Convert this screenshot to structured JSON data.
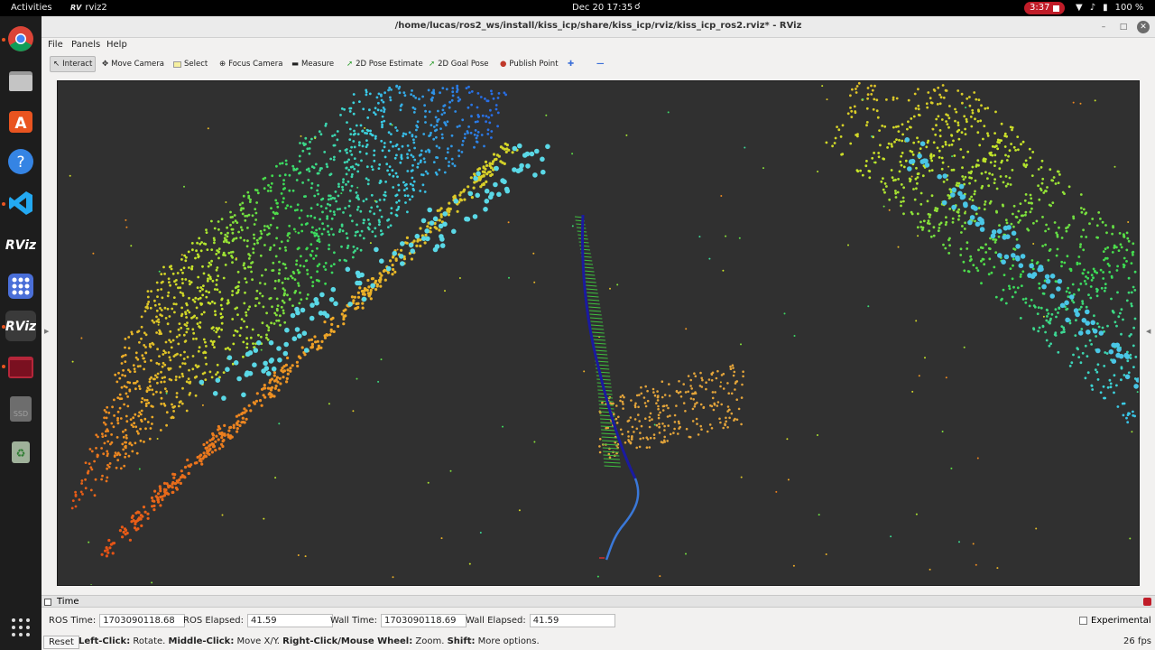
{
  "topbar": {
    "activities": "Activities",
    "app_name": "rviz2",
    "clock": "Dec 20  17:35",
    "recording": "3:37",
    "battery": "100 %"
  },
  "dock": {
    "items": [
      "Google Chrome",
      "Files",
      "Ubuntu Software",
      "Help",
      "Visual Studio Code",
      "RViz",
      "Show Applications",
      "RViz",
      "Terminal",
      "SSD",
      "Trash"
    ]
  },
  "window": {
    "title": "/home/lucas/ros2_ws/install/kiss_icp/share/kiss_icp/rviz/kiss_icp_ros2.rviz* - RViz"
  },
  "menu": {
    "file": "File",
    "panels": "Panels",
    "help": "Help"
  },
  "toolbar": {
    "interact": "Interact",
    "move_camera": "Move Camera",
    "select": "Select",
    "focus_camera": "Focus Camera",
    "measure": "Measure",
    "pose_estimate": "2D Pose Estimate",
    "goal_pose": "2D Goal Pose",
    "publish_point": "Publish Point"
  },
  "time_panel": {
    "title": "Time",
    "ros_time_label": "ROS Time:",
    "ros_time": "1703090118.68",
    "ros_elapsed_label": "ROS Elapsed:",
    "ros_elapsed": "41.59",
    "wall_time_label": "Wall Time:",
    "wall_time": "1703090118.69",
    "wall_elapsed_label": "Wall Elapsed:",
    "wall_elapsed": "41.59",
    "experimental": "Experimental"
  },
  "status": {
    "reset": "Reset",
    "left_click": "Left-Click:",
    "left_click_action": " Rotate. ",
    "middle_click": "Middle-Click:",
    "middle_click_action": " Move X/Y. ",
    "right_click": "Right-Click/Mouse Wheel:",
    "right_click_action": " Zoom. ",
    "shift": "Shift:",
    "shift_action": " More options.",
    "fps": "26 fps"
  },
  "colors": {
    "viewport_bg": "#303030",
    "trajectory_blue": "#3a78d8",
    "trajectory_dark": "#1a1aa0",
    "accent_record": "#c01c28"
  }
}
